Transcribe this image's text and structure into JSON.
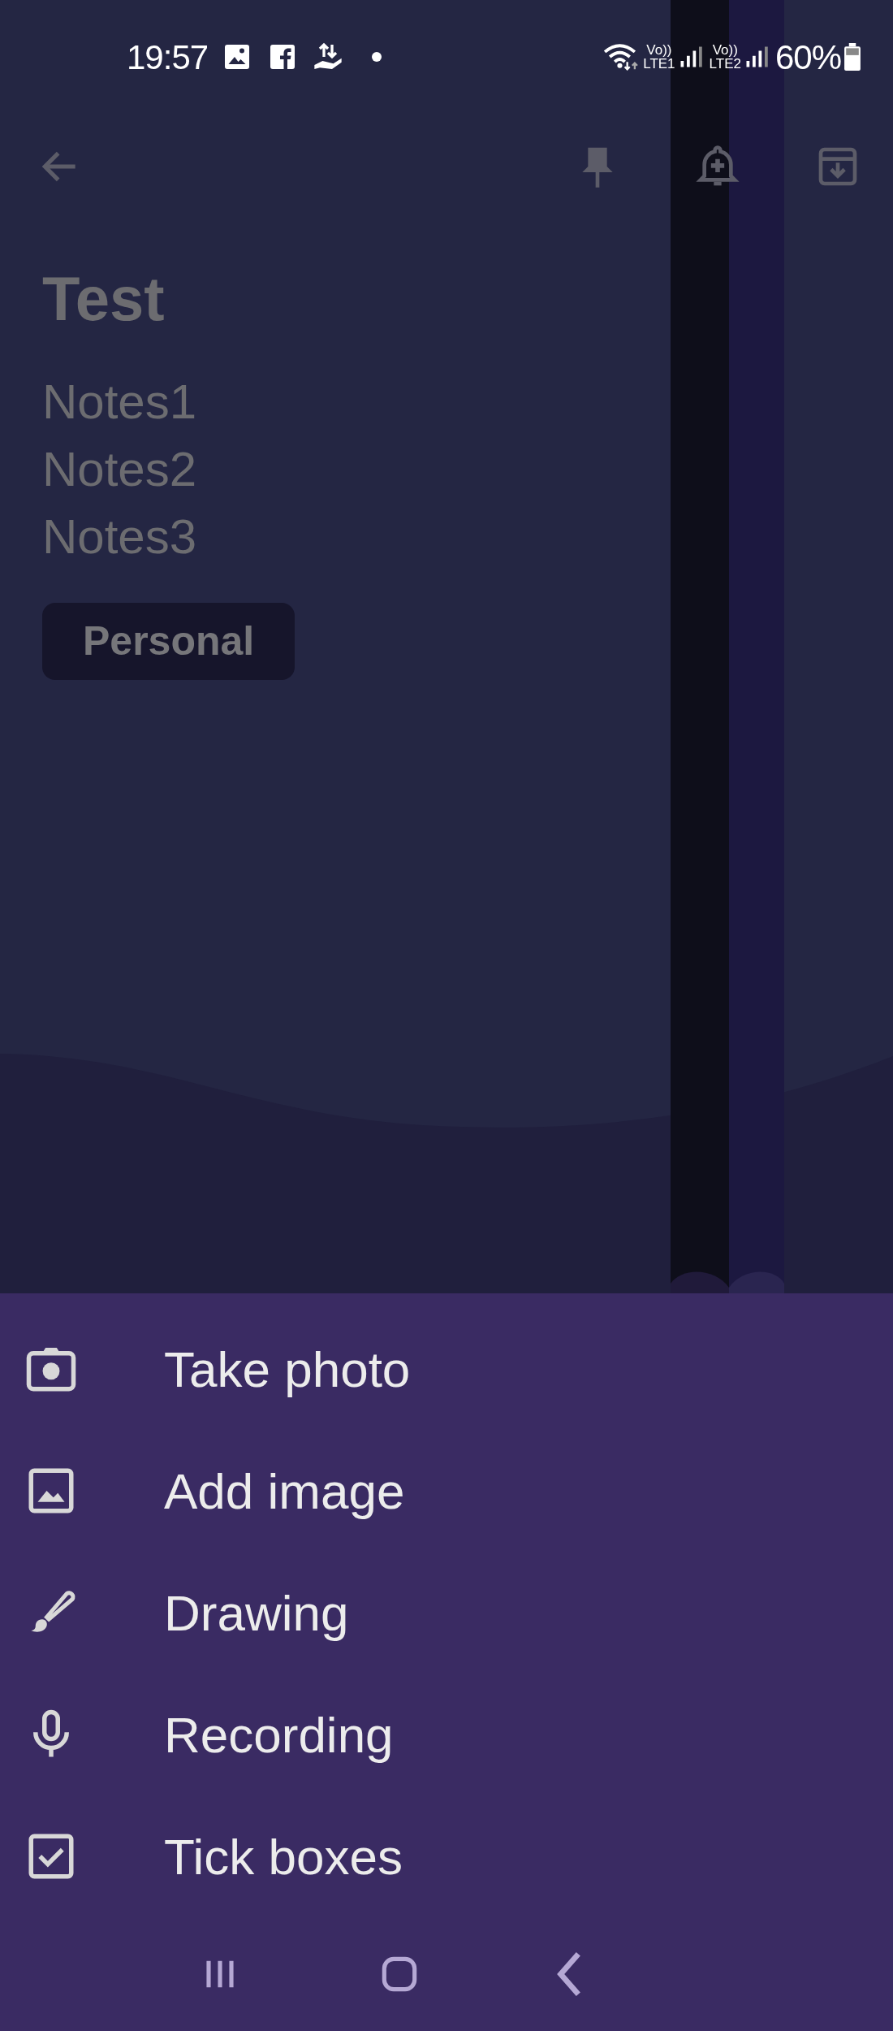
{
  "status_bar": {
    "time": "19:57",
    "signals": [
      {
        "top": "Vo))",
        "bottom": "LTE1"
      },
      {
        "top": "Vo))",
        "bottom": "LTE2"
      }
    ],
    "battery": "60%"
  },
  "note": {
    "title": "Test",
    "lines": [
      "Notes1",
      "Notes2",
      "Notes3"
    ],
    "labels": [
      "Personal"
    ]
  },
  "menu": [
    {
      "kind": "camera",
      "label": "Take photo"
    },
    {
      "kind": "image",
      "label": "Add image"
    },
    {
      "kind": "brush",
      "label": "Drawing"
    },
    {
      "kind": "mic",
      "label": "Recording"
    },
    {
      "kind": "checkbox",
      "label": "Tick boxes"
    }
  ]
}
